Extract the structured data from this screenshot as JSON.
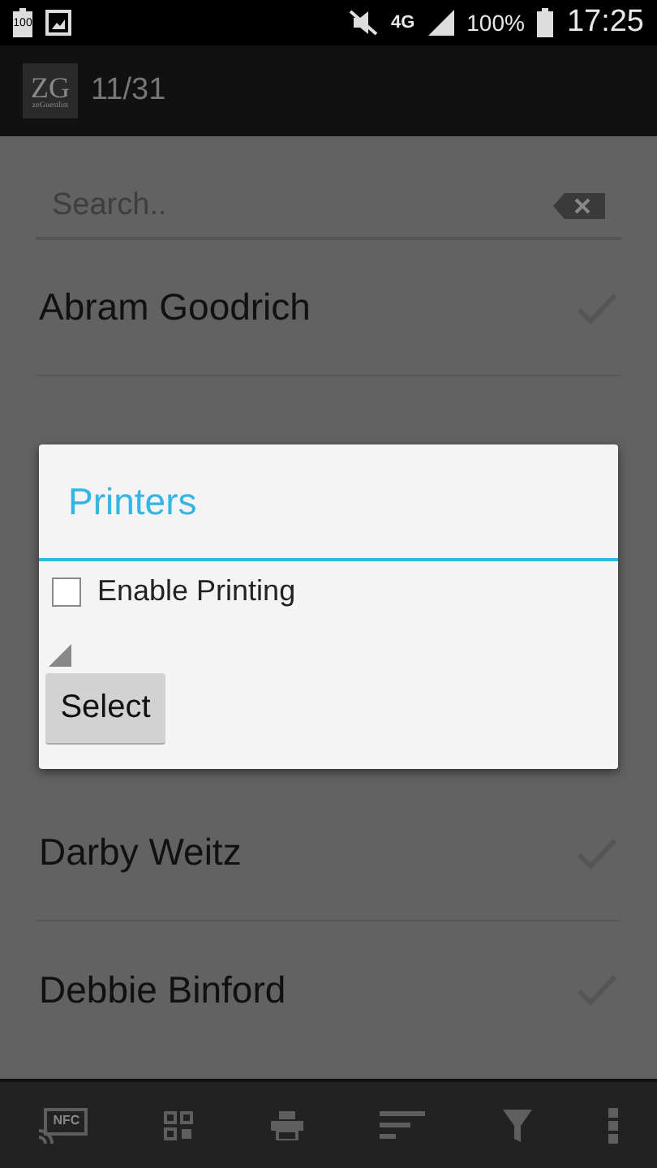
{
  "status_bar": {
    "battery_badge": "100",
    "network": "4G",
    "battery": "100%",
    "time": "17:25"
  },
  "action_bar": {
    "logo": "ZG",
    "logo_caption": "zeGuestlist",
    "count": "11/31"
  },
  "search": {
    "placeholder": "Search.."
  },
  "guests_top": [
    {
      "name": "Abram Goodrich"
    }
  ],
  "guests_bottom": [
    {
      "name": "Darby Weitz"
    },
    {
      "name": "Debbie Binford"
    }
  ],
  "dialog": {
    "title": "Printers",
    "option": {
      "label": "Enable Printing",
      "checked": false
    },
    "button": "Select"
  },
  "bottom_bar": {
    "nfc_label": "NFC"
  }
}
